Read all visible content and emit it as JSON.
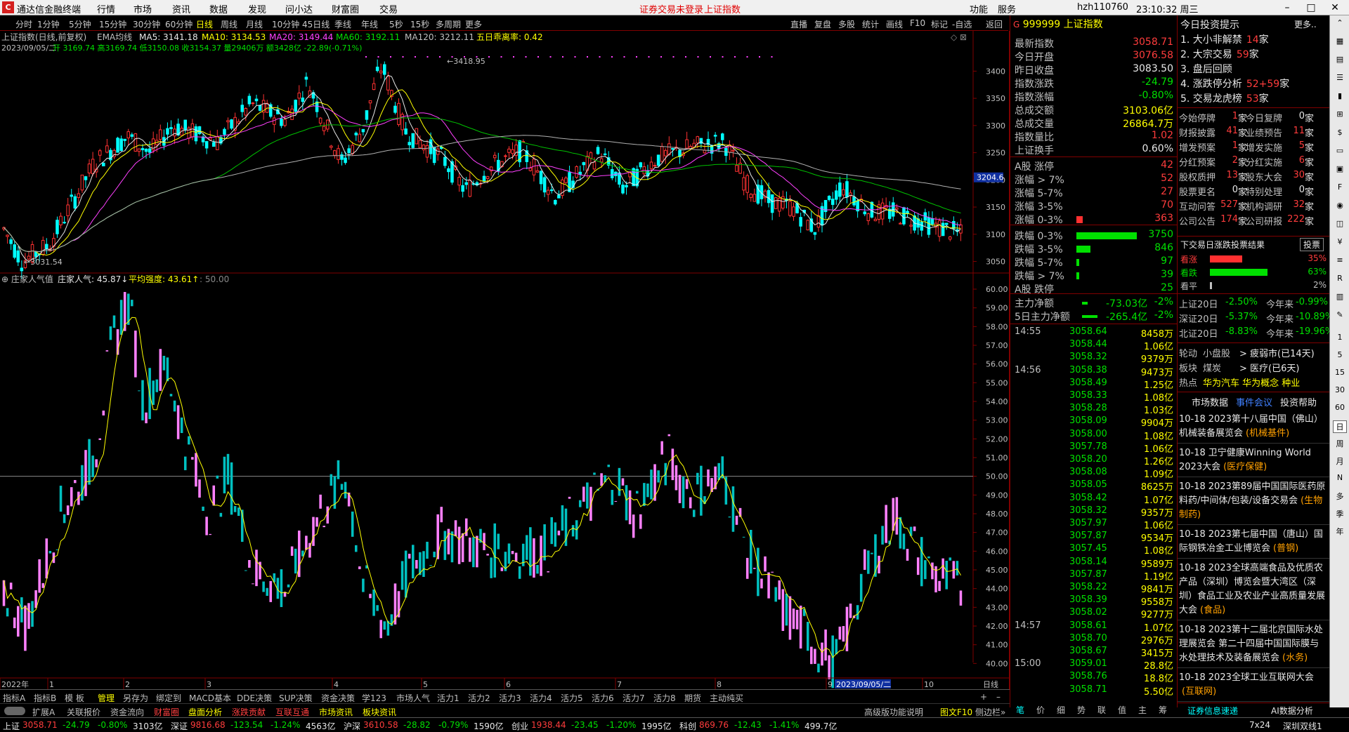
{
  "app": {
    "title": "通达信金融终端"
  },
  "menu": [
    "行情",
    "市场",
    "资讯",
    "数据",
    "发现",
    "问小达",
    "财富圈",
    "交易"
  ],
  "menu_warning": [
    "证券交易未登录",
    "上证指数"
  ],
  "menu_right": {
    "func": "功能",
    "service": "服务",
    "account": "hzh110760",
    "time": "23:10:32 周三"
  },
  "periods": [
    "分时",
    "1分钟",
    "5分钟",
    "15分钟",
    "30分钟",
    "60分钟",
    "日线",
    "周线",
    "月线",
    "10分钟",
    "45日线",
    "季线",
    "年线",
    "5秒",
    "15秒",
    "多周期",
    "更多"
  ],
  "periods_selected": "日线",
  "top_tools": [
    "直播",
    "复盘",
    "多股",
    "统计",
    "画线",
    "F10",
    "标记",
    "-自选",
    "返回"
  ],
  "chart_header": {
    "name": "上证指数(日线,前复权)",
    "ema": "EMA均线",
    "ma5": "MA5: 3141.18",
    "ma10": "MA10: 3134.53",
    "ma20": "MA20: 3149.44",
    "ma60": "MA60: 3192.11",
    "ma120": "MA120: 3212.11",
    "extra": "五日乖离率: 0.42",
    "date": "2023/09/05/二",
    "ohlc_open": "开 3169.74",
    "ohlc_high": "高3169.74",
    "ohlc_low": "低3150.08",
    "ohlc_close": "收3154.37",
    "ohlc_vol": "量29406万",
    "ohlc_amt": "额3428亿",
    "ohlc_chg": "-22.89(-0.71%)"
  },
  "main_price_axis": [
    "3400",
    "3350",
    "3300",
    "3250",
    "3200",
    "3150",
    "3100",
    "3050"
  ],
  "current_price_tag": "3204.6",
  "high_label": "3418.95",
  "low_label": "3031.54",
  "indicator_header": {
    "name": "庄家人气值",
    "v1": "庄家人气: 45.87",
    "v2": "平均强度: 43.61",
    "v3": ": 50.00"
  },
  "indicator_axis": [
    "60.00",
    "59.00",
    "58.00",
    "57.00",
    "56.00",
    "55.00",
    "54.00",
    "53.00",
    "52.00",
    "51.00",
    "50.00",
    "49.00",
    "48.00",
    "47.00",
    "46.00",
    "45.00",
    "44.00",
    "43.00",
    "42.00",
    "41.00",
    "40.00"
  ],
  "x_axis_labels": [
    "2022年",
    "1",
    "2",
    "3",
    "4",
    "5",
    "6",
    "7",
    "8",
    "9",
    "10"
  ],
  "cursor_date": "2023/09/05/二",
  "date_axis_right": "日线",
  "bottom_tabs_1": [
    "指标A",
    "指标B",
    "模 板",
    "管理",
    "另存为",
    "绑定到",
    "MACD基本",
    "DDE决策",
    "SUP决策",
    "资金决策",
    "学123",
    "市场人气",
    "活力1",
    "活力2",
    "活力3",
    "活力4",
    "活力5",
    "活力6",
    "活力7",
    "活力8",
    "期货",
    "主动纯买"
  ],
  "bottom_tabs_2": [
    "扩展A",
    "关联报价",
    "资金流向",
    "财富圈",
    "盘面分析",
    "涨跌贡献",
    "互联互通",
    "市场资讯",
    "板块资讯"
  ],
  "quote": {
    "code": "999999",
    "name": "上证指数",
    "rows": [
      {
        "l": "最新指数",
        "v": "3058.71",
        "c": "red"
      },
      {
        "l": "今日开盘",
        "v": "3076.58",
        "c": "red"
      },
      {
        "l": "昨日收盘",
        "v": "3083.50",
        "c": "wht"
      },
      {
        "l": "指数涨跌",
        "v": "-24.79",
        "c": "grn"
      },
      {
        "l": "指数涨幅",
        "v": "-0.80%",
        "c": "grn"
      },
      {
        "l": "总成交额",
        "v": "3103.06亿",
        "c": "yel"
      },
      {
        "l": "总成交量",
        "v": "26864.7万",
        "c": "yel"
      },
      {
        "l": "指数量比",
        "v": "1.02",
        "c": "red"
      },
      {
        "l": "上证换手",
        "v": "0.60%",
        "c": "wht"
      }
    ],
    "dist": [
      {
        "l": "A股 涨停",
        "v": "42",
        "c": "red",
        "frac": 0
      },
      {
        "l": "涨幅 > 7%",
        "v": "52",
        "c": "red",
        "frac": 0
      },
      {
        "l": "涨幅 5-7%",
        "v": "27",
        "c": "red",
        "frac": 0
      },
      {
        "l": "涨幅 3-5%",
        "v": "70",
        "c": "red",
        "frac": 0
      },
      {
        "l": "涨幅 0-3%",
        "v": "363",
        "c": "red",
        "frac": 0.1
      },
      {
        "l": "跌幅 0-3%",
        "v": "3750",
        "c": "grn",
        "frac": 1
      },
      {
        "l": "跌幅 3-5%",
        "v": "846",
        "c": "grn",
        "frac": 0.23
      },
      {
        "l": "跌幅 5-7%",
        "v": "97",
        "c": "grn",
        "frac": 0.03
      },
      {
        "l": "跌幅 > 7%",
        "v": "39",
        "c": "grn",
        "frac": 0.01
      },
      {
        "l": "A股 跌停",
        "v": "25",
        "c": "grn",
        "frac": 0
      }
    ],
    "flow": [
      {
        "l": "主力净额",
        "v": "-73.03亿",
        "p": "-2%"
      },
      {
        "l": "5日主力净额",
        "v": "-265.4亿",
        "p": "-2%"
      }
    ]
  },
  "ticks": [
    {
      "t": "14:55",
      "p": "3058.64",
      "v": "8458万"
    },
    {
      "t": "",
      "p": "3058.44",
      "v": "1.06亿"
    },
    {
      "t": "",
      "p": "3058.32",
      "v": "9379万"
    },
    {
      "t": "14:56",
      "p": "3058.38",
      "v": "9473万"
    },
    {
      "t": "",
      "p": "3058.49",
      "v": "1.25亿"
    },
    {
      "t": "",
      "p": "3058.33",
      "v": "1.08亿"
    },
    {
      "t": "",
      "p": "3058.28",
      "v": "1.03亿"
    },
    {
      "t": "",
      "p": "3058.09",
      "v": "9904万"
    },
    {
      "t": "",
      "p": "3058.00",
      "v": "1.08亿"
    },
    {
      "t": "",
      "p": "3057.78",
      "v": "1.06亿"
    },
    {
      "t": "",
      "p": "3058.20",
      "v": "1.26亿"
    },
    {
      "t": "",
      "p": "3058.08",
      "v": "1.09亿"
    },
    {
      "t": "",
      "p": "3058.05",
      "v": "8625万"
    },
    {
      "t": "",
      "p": "3058.42",
      "v": "1.07亿"
    },
    {
      "t": "",
      "p": "3058.32",
      "v": "9357万"
    },
    {
      "t": "",
      "p": "3057.97",
      "v": "1.06亿"
    },
    {
      "t": "",
      "p": "3057.87",
      "v": "9534万"
    },
    {
      "t": "",
      "p": "3057.45",
      "v": "1.08亿"
    },
    {
      "t": "",
      "p": "3058.14",
      "v": "9589万"
    },
    {
      "t": "",
      "p": "3057.87",
      "v": "1.19亿"
    },
    {
      "t": "",
      "p": "3058.22",
      "v": "9841万"
    },
    {
      "t": "",
      "p": "3058.39",
      "v": "9558万"
    },
    {
      "t": "",
      "p": "3058.02",
      "v": "9277万"
    },
    {
      "t": "14:57",
      "p": "3058.61",
      "v": "1.07亿"
    },
    {
      "t": "",
      "p": "3058.70",
      "v": "2976万"
    },
    {
      "t": "",
      "p": "3058.67",
      "v": "3415万"
    },
    {
      "t": "15:00",
      "p": "3059.01",
      "v": "28.8亿"
    },
    {
      "t": "",
      "p": "3058.76",
      "v": "18.8亿"
    },
    {
      "t": "",
      "p": "3058.71",
      "v": "5.50亿"
    }
  ],
  "mini_tabs": [
    "笔",
    "价",
    "细",
    "势",
    "联",
    "值",
    "主",
    "筹"
  ],
  "tips": {
    "title": "今日投资提示",
    "more": "更多..",
    "items": [
      {
        "n": "1. 大小非解禁",
        "v": "14",
        "u": "家"
      },
      {
        "n": "2. 大宗交易",
        "v": "59",
        "u": "家"
      },
      {
        "n": "3. 盘后回顾",
        "v": "",
        "u": ""
      },
      {
        "n": "4. 涨跌停分析",
        "v": "52+59",
        "u": "家"
      },
      {
        "n": "5. 交易龙虎榜",
        "v": "53",
        "u": "家"
      }
    ],
    "grid": [
      [
        "今始停牌",
        "1",
        "今日复牌",
        "0"
      ],
      [
        "财报披露",
        "41",
        "业绩预告",
        "11"
      ],
      [
        "增发预案",
        "1",
        "增发实施",
        "5"
      ],
      [
        "分红预案",
        "2",
        "分红实施",
        "6"
      ],
      [
        "股权质押",
        "13",
        "股东大会",
        "30"
      ],
      [
        "股票更名",
        "0",
        "特别处理",
        "0"
      ],
      [
        "互动问答",
        "527",
        "机构调研",
        "32"
      ],
      [
        "公司公告",
        "174",
        "公司研报",
        "222"
      ]
    ]
  },
  "vote": {
    "title": "下交易日涨跌投票结果",
    "btn": "投票",
    "rows": [
      {
        "l": "看涨",
        "p": "35%",
        "frac": 0.35,
        "c": "#ff3030"
      },
      {
        "l": "看跌",
        "p": "63%",
        "frac": 0.63,
        "c": "#00e000"
      },
      {
        "l": "看平",
        "p": "2%",
        "frac": 0.02,
        "c": "#c0c0c0"
      }
    ]
  },
  "market20": [
    {
      "l": "上证20日",
      "a": "-2.50%",
      "b": "今年来",
      "c": "-0.99%"
    },
    {
      "l": "深证20日",
      "a": "-5.37%",
      "b": "今年来",
      "c": "-10.89%"
    },
    {
      "l": "北证20日",
      "a": "-8.83%",
      "b": "今年来",
      "c": "-19.96%"
    }
  ],
  "rotation": [
    {
      "l": "轮动",
      "a": "小盘股",
      "b": "> 疲弱市(已14天)"
    },
    {
      "l": "板块",
      "a": "煤炭",
      "b": "> 医疗(已6天)"
    },
    {
      "l": "热点",
      "a": "华为汽车 华为概念 种业",
      "b": ""
    }
  ],
  "news_tabs": [
    "市场数据",
    "事件会议",
    "投资帮助"
  ],
  "news": [
    {
      "d": "10-18",
      "t": "2023第十八届中国（佛山）机械装备展览会",
      "tag": "(机械基件)"
    },
    {
      "d": "10-18",
      "t": "卫宁健康Winning World 2023大会",
      "tag": "(医疗保健)"
    },
    {
      "d": "10-18",
      "t": "2023第89届中国国际医药原料药/中间体/包装/设备交易会",
      "tag": "(生物制药)"
    },
    {
      "d": "10-18",
      "t": "2023第七届中国（唐山）国际钢铁冶金工业博览会",
      "tag": "(普钢)"
    },
    {
      "d": "10-18",
      "t": "2023全球高端食品及优质农产品（深圳）博览会暨大湾区（深圳）食品工业及农业产业高质量发展大会",
      "tag": "(食品)"
    },
    {
      "d": "10-18",
      "t": "2023第十二届北京国际水处理展览会 第二十四届中国国际膜与水处理技术及装备展览会",
      "tag": "(水务)"
    },
    {
      "d": "10-18",
      "t": "2023全球工业互联网大会",
      "tag": "(互联网)"
    }
  ],
  "bottom_right": {
    "a": "证券信息速递",
    "b": "AI数据分析",
    "c": "高级版功能说明",
    "d": "图文F10",
    "e": "侧边栏»",
    "f": "7x24",
    "g": "深圳双线1"
  },
  "status": [
    {
      "n": "上证",
      "p": "3058.71",
      "c": "-24.79",
      "r": "-0.80%",
      "v": "3103亿"
    },
    {
      "n": "深证",
      "p": "9816.68",
      "c": "-123.54",
      "r": "-1.24%",
      "v": "4563亿"
    },
    {
      "n": "沪深",
      "p": "3610.58",
      "c": "-28.82",
      "r": "-0.79%",
      "v": "1590亿"
    },
    {
      "n": "创业",
      "p": "1938.44",
      "c": "-23.45",
      "r": "-1.20%",
      "v": "1995亿"
    },
    {
      "n": "科创",
      "p": "869.76",
      "c": "-12.43",
      "r": "-1.41%",
      "v": "499.7亿"
    }
  ],
  "icons": [
    "chevron-up-icon",
    "grid-icon",
    "chart-icon",
    "list-icon",
    "bar-icon",
    "plus-icon",
    "dollar-icon",
    "doc-icon",
    "news-icon",
    "f10-icon",
    "eye-icon",
    "layers-icon",
    "money-icon",
    "lines-icon",
    "rsi-icon",
    "candle-icon",
    "pencil-icon"
  ],
  "iconbar_text": [
    "1",
    "5",
    "15",
    "30",
    "60",
    "日",
    "周",
    "月",
    "N",
    "多",
    "季",
    "年"
  ]
}
